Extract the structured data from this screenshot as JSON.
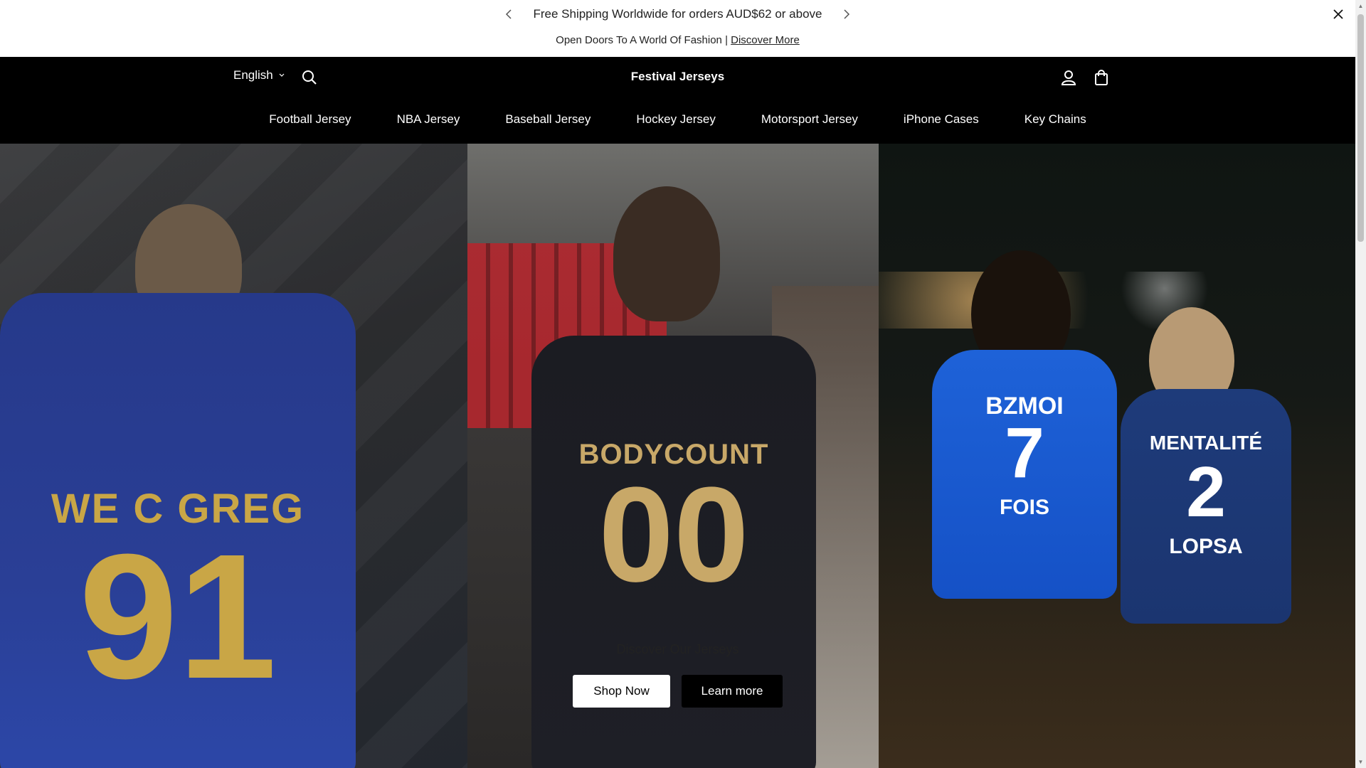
{
  "announcement": {
    "message": "Free Shipping Worldwide for orders AUD$62 or above",
    "secondary_text": "Open Doors To A World Of Fashion |",
    "secondary_link": "Discover More",
    "prev_icon": "chevron-left-icon",
    "next_icon": "chevron-right-icon",
    "close_icon": "close-icon"
  },
  "header": {
    "language": "English",
    "brand": "Festival Jerseys",
    "search_icon": "search-icon",
    "account_icon": "user-icon",
    "cart_icon": "shopping-bag-icon"
  },
  "nav": {
    "items": [
      {
        "label": "Football Jersey"
      },
      {
        "label": "NBA Jersey"
      },
      {
        "label": "Baseball Jersey"
      },
      {
        "label": "Hockey Jersey"
      },
      {
        "label": "Motorsport Jersey"
      },
      {
        "label": "iPhone Cases"
      },
      {
        "label": "Key Chains"
      }
    ]
  },
  "hero": {
    "title": "Discover Our Jerseys",
    "primary_button": "Shop Now",
    "secondary_button": "Learn more",
    "panels": [
      {
        "jersey_name": "WE C GREG",
        "jersey_number": "91"
      },
      {
        "jersey_name": "BODYCOUNT",
        "jersey_number": "00"
      },
      {
        "jersey_name": "BZMOI",
        "jersey_number": "7",
        "jersey_sub": "FOIS",
        "jersey_name_2": "MENTALITÉ",
        "jersey_number_2": "2",
        "jersey_sub_2": "LOPSA"
      }
    ]
  },
  "colors": {
    "header_bg": "#000000",
    "announcement_bg": "#ffffff",
    "primary_button_bg": "#ffffff",
    "secondary_button_bg": "#000000"
  }
}
